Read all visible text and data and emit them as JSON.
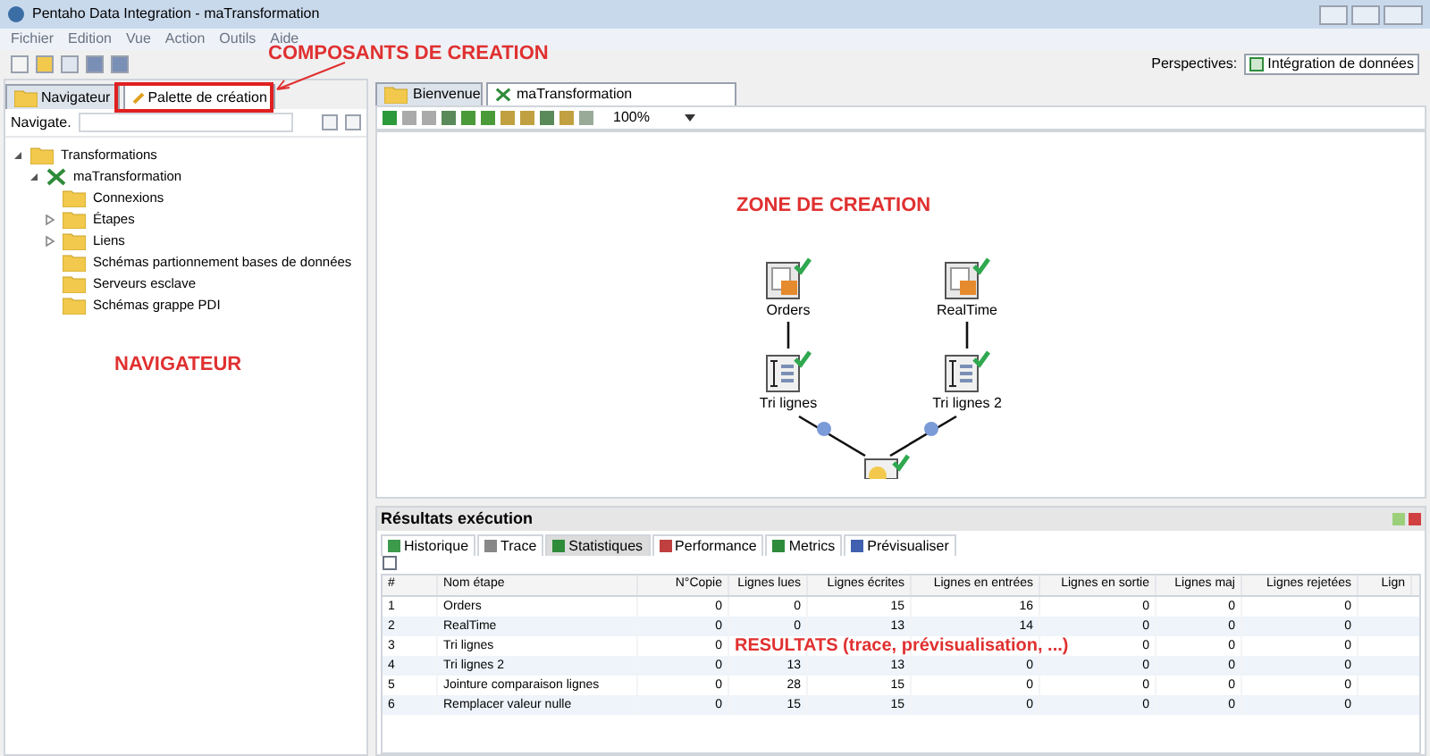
{
  "window": {
    "title": "Pentaho Data Integration - maTransformation"
  },
  "menu": [
    "Fichier",
    "Edition",
    "Vue",
    "Action",
    "Outils",
    "Aide"
  ],
  "perspectives": {
    "label": "Perspectives:",
    "button": "Intégration de données"
  },
  "left_tabs": [
    {
      "label": "Navigateur",
      "selected": false
    },
    {
      "label": "Palette de création",
      "selected": true
    }
  ],
  "search": {
    "label": "Navigate."
  },
  "tree": [
    {
      "label": "Transformations",
      "expanded": true,
      "children": [
        {
          "label": "maTransformation",
          "expanded": true,
          "children": [
            {
              "label": "Connexions"
            },
            {
              "label": "Étapes",
              "expanded": false
            },
            {
              "label": "Liens",
              "expanded": false
            },
            {
              "label": "Schémas partionnement bases de données"
            },
            {
              "label": "Serveurs esclave"
            },
            {
              "label": "Schémas grappe PDI"
            }
          ]
        }
      ]
    }
  ],
  "editor_tabs": [
    {
      "label": "Bienvenue",
      "selected": false
    },
    {
      "label": "maTransformation",
      "selected": true
    }
  ],
  "zoom": "100%",
  "canvas": {
    "nodes": [
      {
        "label": "Orders",
        "kind": "input"
      },
      {
        "label": "RealTime",
        "kind": "input"
      },
      {
        "label": "Tri lignes",
        "kind": "sort"
      },
      {
        "label": "Tri lignes 2",
        "kind": "sort"
      },
      {
        "kind": "join"
      }
    ]
  },
  "results": {
    "title": "Résultats exécution",
    "tabs": [
      {
        "label": "Historique",
        "selected": false
      },
      {
        "label": "Trace",
        "selected": false
      },
      {
        "label": "Statistiques",
        "selected": true
      },
      {
        "label": "Performance",
        "selected": false
      },
      {
        "label": "Metrics",
        "selected": false
      },
      {
        "label": "Prévisualiser",
        "selected": false
      }
    ],
    "columns": [
      "#",
      "Nom étape",
      "N°Copie",
      "Lignes lues",
      "Lignes écrites",
      "Lignes en entrées",
      "Lignes en sortie",
      "Lignes maj",
      "Lignes rejetées",
      "Lign"
    ],
    "rows": [
      [
        "1",
        "Orders",
        "0",
        "0",
        "15",
        "16",
        "0",
        "0",
        "0"
      ],
      [
        "2",
        "RealTime",
        "0",
        "0",
        "13",
        "14",
        "0",
        "0",
        "0"
      ],
      [
        "3",
        "Tri lignes",
        "0",
        null,
        null,
        null,
        "0",
        "0",
        "0"
      ],
      [
        "4",
        "Tri lignes 2",
        "0",
        "13",
        "13",
        "0",
        "0",
        "0",
        "0"
      ],
      [
        "5",
        "Jointure comparaison lignes",
        "0",
        "28",
        "15",
        "0",
        "0",
        "0",
        "0"
      ],
      [
        "6",
        "Remplacer valeur nulle",
        "0",
        "15",
        "15",
        "0",
        "0",
        "0",
        "0"
      ]
    ]
  },
  "annotations": [
    "COMPOSANTS DE CREATION",
    "ZONE DE CREATION",
    "NAVIGATEUR",
    "RESULTATS (trace, prévisualisation, ...)"
  ]
}
